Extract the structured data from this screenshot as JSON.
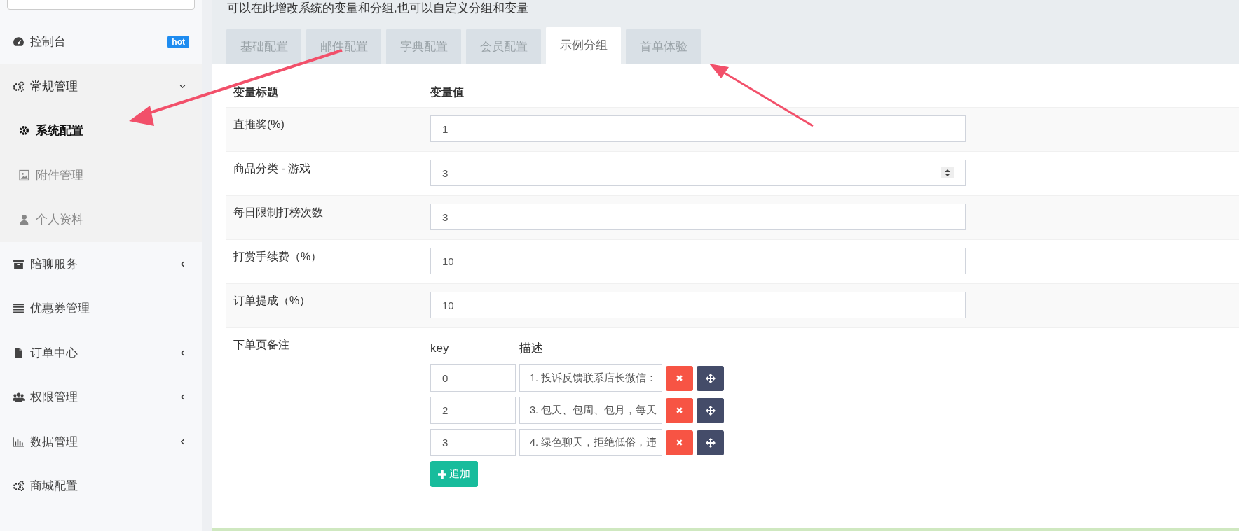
{
  "sidebar": {
    "items": [
      {
        "label": "控制台",
        "badge": "hot"
      },
      {
        "label": "常规管理",
        "expanded": true,
        "children": [
          {
            "label": "系统配置",
            "selected": true
          },
          {
            "label": "附件管理",
            "selected": false
          },
          {
            "label": "个人资料",
            "selected": false
          }
        ]
      },
      {
        "label": "陪聊服务",
        "expanded": false
      },
      {
        "label": "优惠券管理"
      },
      {
        "label": "订单中心",
        "expanded": false
      },
      {
        "label": "权限管理",
        "expanded": false
      },
      {
        "label": "数据管理",
        "expanded": false
      },
      {
        "label": "商城配置"
      }
    ]
  },
  "intro": "可以在此增改系统的变量和分组,也可以自定义分组和变量",
  "tabs": [
    {
      "label": "基础配置",
      "selected": false
    },
    {
      "label": "邮件配置",
      "selected": false
    },
    {
      "label": "字典配置",
      "selected": false
    },
    {
      "label": "会员配置",
      "selected": false
    },
    {
      "label": "示例分组",
      "selected": true
    },
    {
      "label": "首单体验",
      "selected": false
    }
  ],
  "table": {
    "columns": [
      "变量标题",
      "变量值"
    ],
    "rows": [
      {
        "label": "直推奖(%)",
        "kind": "text",
        "value": "1"
      },
      {
        "label": "商品分类 - 游戏",
        "kind": "number",
        "value": "3"
      },
      {
        "label": "每日限制打榜次数",
        "kind": "text",
        "value": "3"
      },
      {
        "label": "打赏手续费（%）",
        "kind": "text",
        "value": "10"
      },
      {
        "label": "订单提成（%）",
        "kind": "text",
        "value": "10"
      },
      {
        "label": "下单页备注",
        "kind": "array",
        "columns": [
          "key",
          "描述"
        ],
        "items": [
          {
            "key": "0",
            "description": "1. 投诉反馈联系店长微信："
          },
          {
            "key": "2",
            "description": "3. 包天、包周、包月，每天"
          },
          {
            "key": "3",
            "description": "4. 绿色聊天，拒绝低俗，违"
          }
        ],
        "add_button": "追加"
      }
    ]
  }
}
